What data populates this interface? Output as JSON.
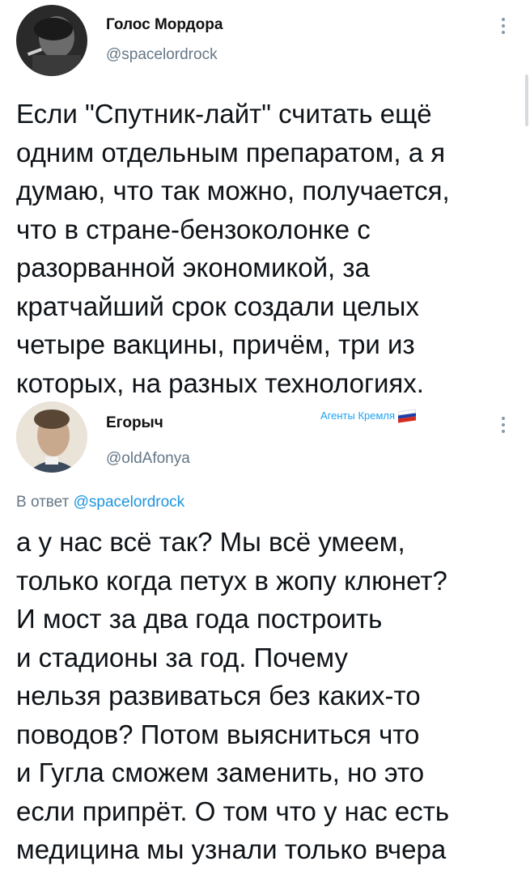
{
  "tweet1": {
    "author_name": "Голос Мордора",
    "author_handle": "@spacelordrock",
    "text_lines": [
      "Если \"Спутник-лайт\" считать ещё",
      "одним отдельным препаратом, а я",
      "думаю, что так можно, получается,",
      "что в стране-бензоколонке с",
      "разорванной экономикой, за",
      "кратчайший срок создали целых",
      "четыре вакцины, причём, три из",
      "которых, на разных технологиях."
    ]
  },
  "tweet2": {
    "author_name": "Егорыч",
    "author_handle": "@oldAfonya",
    "badge_text": "Агенты Кремля",
    "flag_colors": [
      "#ffffff",
      "#1c3fa8",
      "#d52b1e"
    ],
    "reply_prefix": "В ответ",
    "reply_handle": "@spacelordrock",
    "text_lines": [
      "а у нас всё так? Мы всё умеем,",
      "только когда петух в жопу клюнет?",
      "И мост за два года построить",
      "и стадионы за год. Почему",
      "нельзя развиваться без каких-то",
      "поводов? Потом выясниться что",
      "и Гугла сможем заменить, но это",
      "если припрёт. О том что у нас есть",
      "медицина мы узнали только вчера"
    ]
  },
  "icons": {
    "more": "more-vertical-icon",
    "flag": "russian-flag-icon"
  }
}
